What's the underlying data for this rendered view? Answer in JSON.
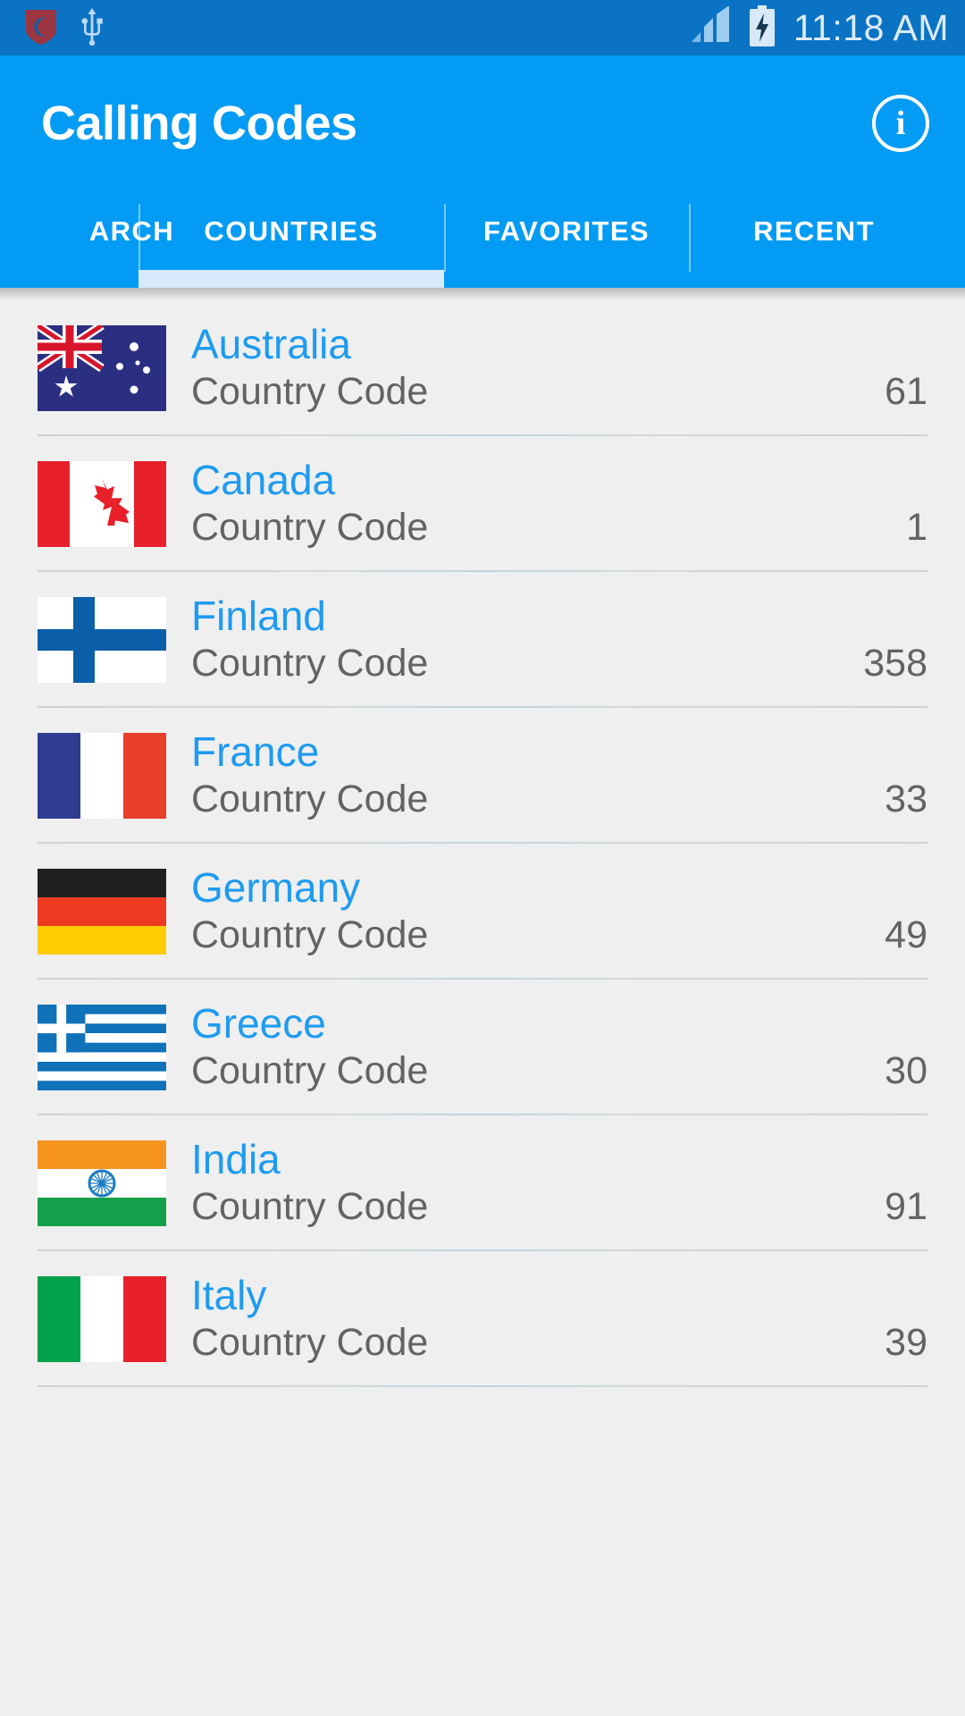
{
  "status_bar": {
    "icons": [
      "shield-icon",
      "usb-icon",
      "signal-icon",
      "battery-charging-icon"
    ],
    "time": "11:18 AM",
    "background": "#0A73C4"
  },
  "app_bar": {
    "title": "Calling Codes",
    "info_label": "i",
    "background": "#039BF4",
    "accent": "#D6EAFB"
  },
  "tabs": [
    {
      "label": "ARCH",
      "selected": false
    },
    {
      "label": "COUNTRIES",
      "selected": true
    },
    {
      "label": "FAVORITES",
      "selected": false
    },
    {
      "label": "RECENT",
      "selected": false
    }
  ],
  "list": {
    "code_label": "Country Code",
    "name_color": "#1E9BF0",
    "value_color": "#636363",
    "items": [
      {
        "country": "Australia",
        "flag": "au",
        "code_label": "Country Code",
        "code": "61"
      },
      {
        "country": "Canada",
        "flag": "ca",
        "code_label": "Country Code",
        "code": "1"
      },
      {
        "country": "Finland",
        "flag": "fi",
        "code_label": "Country Code",
        "code": "358"
      },
      {
        "country": "France",
        "flag": "fr",
        "code_label": "Country Code",
        "code": "33"
      },
      {
        "country": "Germany",
        "flag": "de",
        "code_label": "Country Code",
        "code": "49"
      },
      {
        "country": "Greece",
        "flag": "gr",
        "code_label": "Country Code",
        "code": "30"
      },
      {
        "country": "India",
        "flag": "in",
        "code_label": "Country Code",
        "code": "91"
      },
      {
        "country": "Italy",
        "flag": "it",
        "code_label": "Country Code",
        "code": "39"
      }
    ]
  }
}
